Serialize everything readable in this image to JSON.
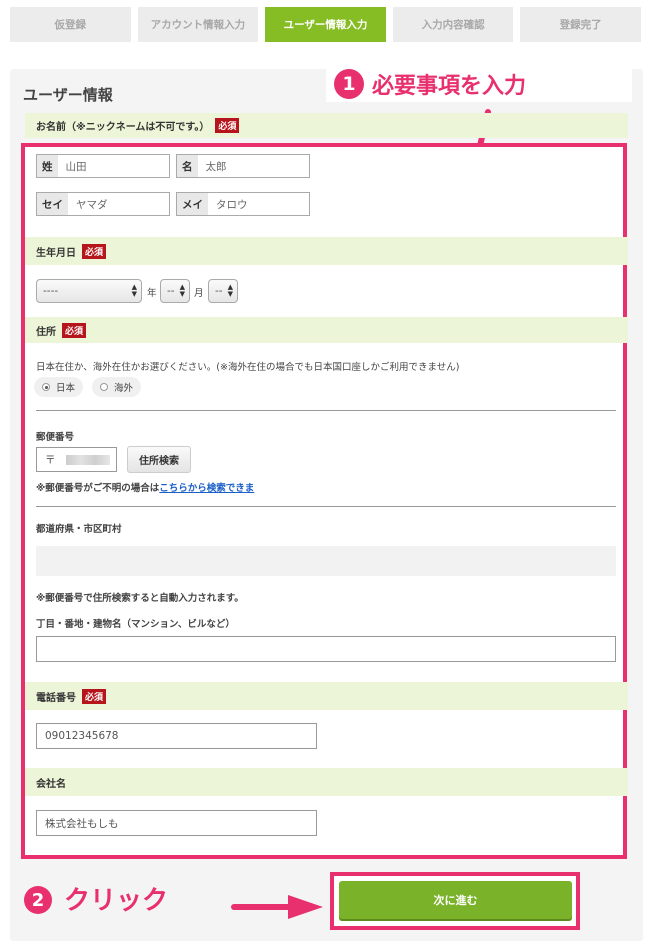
{
  "steps": [
    "仮登録",
    "アカウント情報入力",
    "ユーザー情報入力",
    "入力内容確認",
    "登録完了"
  ],
  "active_step": 2,
  "panel_title": "ユーザー情報",
  "annotation1": {
    "num": "1",
    "text": "必要事項を入力"
  },
  "annotation2": {
    "num": "2",
    "text": "クリック"
  },
  "name_section": {
    "label": "お名前（※ニックネームは不可です。）",
    "required": "必須",
    "sei_label": "姓",
    "sei_value": "山田",
    "mei_label": "名",
    "mei_value": "太郎",
    "sei_kana_label": "セイ",
    "sei_kana_value": "ヤマダ",
    "mei_kana_label": "メイ",
    "mei_kana_value": "タロウ"
  },
  "birth_section": {
    "label": "生年月日",
    "required": "必須",
    "year_value": "----",
    "year_unit": "年",
    "month_value": "--",
    "month_unit": "月",
    "day_value": "--"
  },
  "address_section": {
    "label": "住所",
    "required": "必須",
    "residence_note": "日本在住か、海外在住かお選びください。(※海外在住の場合でも日本国口座しかご利用できません)",
    "radio_japan": "日本",
    "radio_overseas": "海外",
    "selected": "日本",
    "postal_label": "郵便番号",
    "postal_prefix": "〒",
    "postal_search_button": "住所検索",
    "postal_note_prefix": "※郵便番号がご不明の場合は",
    "postal_note_link": "こちらから検索できま",
    "pref_label": "都道府県・市区町村",
    "auto_note": "※郵便番号で住所検索すると自動入力されます。",
    "street_label": "丁目・番地・建物名（マンション、ビルなど）",
    "street_value": ""
  },
  "phone_section": {
    "label": "電話番号",
    "required": "必須",
    "value": "09012345678"
  },
  "company_section": {
    "label": "会社名",
    "value": "株式会社もしも"
  },
  "submit_label": "次に進む",
  "colors": {
    "accent_green": "#86bd24",
    "highlight_pink": "#e8306e",
    "required_red": "#b5151b",
    "section_bg": "#edf5d8"
  }
}
